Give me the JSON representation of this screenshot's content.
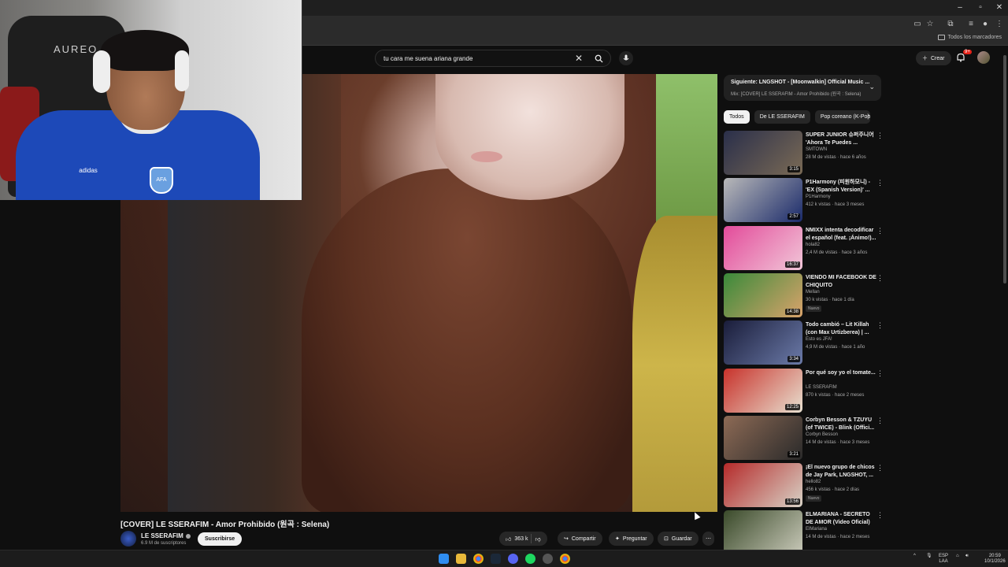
{
  "browser": {
    "bookmarks_label": "Todos los marcadores"
  },
  "header": {
    "search_value": "tu cara me suena ariana grande",
    "create_label": "Crear",
    "notifications_count": "9+"
  },
  "webcam": {
    "chair_brand": "AUREO",
    "shirt_brand": "adidas",
    "shirt_badge": "AFA"
  },
  "video": {
    "title": "[COVER] LE SSERAFIM - Amor Prohibido (원곡 : Selena)",
    "channel": "LE SSERAFIM",
    "subscribers": "6.9 M de suscriptores",
    "subscribe_label": "Suscribirse",
    "likes": "363 k",
    "share_label": "Compartir",
    "ask_label": "Preguntar",
    "save_label": "Guardar"
  },
  "up_next": {
    "title": "Siguiente: LNGSHOT - [Moonwalkin] Official Music ...",
    "subtitle": "Mix: [COVER] LE SSERAFIM - Amor Prohibido (원곡 : Selena)"
  },
  "chips": [
    "Todos",
    "De LE SSERAFIM",
    "Pop coreano (K-Pop)"
  ],
  "recommendations": [
    {
      "title": "SUPER JUNIOR 슈퍼주니어 'Ahora Te Puedes ...",
      "channel": "SMTOWN",
      "meta": "28 M de vistas · hace 6 años",
      "duration": "3:15",
      "colors": [
        "#2a2f4a",
        "#7a6a55"
      ]
    },
    {
      "title": "P1Harmony (피원하모니) - 'EX (Spanish Version)' ...",
      "channel": "P1Harmony",
      "meta": "412 k vistas · hace 3 meses",
      "duration": "2:57",
      "colors": [
        "#b9b9b9",
        "#1b2b6b"
      ]
    },
    {
      "title": "NMIXX intenta decodificar el español (feat. ¡Ánimo!)...",
      "channel": "hola82",
      "meta": "2,4 M de vistas · hace 3 años",
      "duration": "16:37",
      "colors": [
        "#e34b9a",
        "#f1c6d8"
      ]
    },
    {
      "title": "VIENDO MI FACEBOOK DE CHIQUITO",
      "channel": "Mellan",
      "meta": "30 k vistas · hace 1 día",
      "duration": "14:38",
      "colors": [
        "#3a8a3a",
        "#d9a36b"
      ],
      "badge": "Nuevo"
    },
    {
      "title": "Todo cambió – Lit Killah (con Max Urtizberea) | ...",
      "channel": "Esto es JFA!",
      "meta": "4,9 M de vistas · hace 1 año",
      "duration": "3:34",
      "colors": [
        "#1a1d3a",
        "#6b7aa8"
      ]
    },
    {
      "title": "Por qué soy yo el tomate...",
      "channel": "LE SSERAFIM",
      "meta": "870 k vistas · hace 2 meses",
      "duration": "12:25",
      "colors": [
        "#c8322b",
        "#e8e0d0"
      ]
    },
    {
      "title": "Corbyn Besson & TZUYU (of TWICE) - Blink (Offici...",
      "channel": "Corbyn Besson",
      "meta": "14 M de vistas · hace 3 meses",
      "duration": "3:21",
      "colors": [
        "#8d6a55",
        "#2a2a2a"
      ]
    },
    {
      "title": "¡El nuevo grupo de chicos de Jay Park, LNGSHOT, ...",
      "channel": "hello82",
      "meta": "456 k vistas · hace 2 días",
      "duration": "13:56",
      "colors": [
        "#b52a2a",
        "#d8d2c6"
      ],
      "badge": "Nuevo"
    },
    {
      "title": "ELMARIANA - SECRETO DE AMOR (Video Oficial)",
      "channel": "ElMariana",
      "meta": "14 M de vistas · hace 2 meses",
      "duration": "",
      "colors": [
        "#3a4a2a",
        "#c9c9b9"
      ]
    }
  ],
  "taskbar": {
    "lang": "ESP",
    "lang2": "LAA",
    "time": "20:59",
    "date": "10/1/2026"
  }
}
